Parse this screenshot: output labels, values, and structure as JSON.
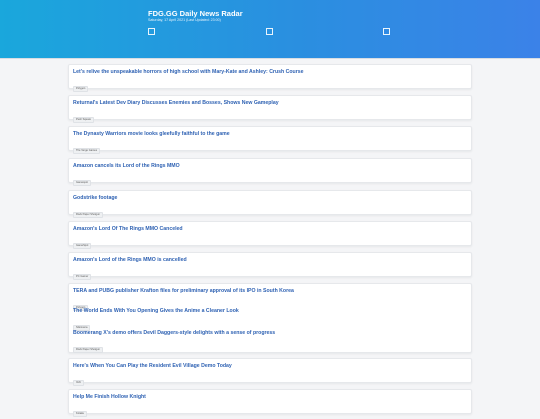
{
  "header": {
    "title": "FDG.GG Daily News Radar",
    "subtitle": "Saturday, 17 April 2021 (Last Updated: 23:00)"
  },
  "feed": {
    "items": [
      {
        "title": "Let's relive the unspeakable horrors of high school with Mary-Kate and Ashley: Crush Course",
        "source": "Polygon"
      },
      {
        "title": "Returnal's Latest Dev Diary Discusses Enemies and Bosses, Shows New Gameplay",
        "source": "Push Square"
      },
      {
        "title": "The Dynasty Warriors movie looks gleefully faithful to the game",
        "source": "The Verge Games"
      },
      {
        "title": "Amazon cancels its Lord of the Rings MMO",
        "source": "Gamespot"
      },
      {
        "title": "Godstrike footage",
        "source": "Rock Paper Shotgun"
      },
      {
        "title": "Amazon's Lord Of The Rings MMO Canceled",
        "source": "GameSpot"
      },
      {
        "title": "Amazon's Lord of the Rings MMO is cancelled",
        "source": "PC Gamer"
      },
      {
        "title": "TERA and PUBG publisher Krafton files for preliminary approval of its IPO in South Korea",
        "source": "Polygon"
      },
      {
        "title": "The World Ends With You Opening Gives the Anime a Cleaner Look",
        "source": "Siliconera"
      },
      {
        "title": "Boomerang X's demo offers Devil Daggers-style delights with a sense of progress",
        "source": "Rock Paper Shotgun"
      },
      {
        "title": "Here's When You Can Play the Resident Evil Village Demo Today",
        "source": "IGN"
      },
      {
        "title": "Help Me Finish Hollow Knight",
        "source": "Kotaku"
      }
    ]
  }
}
